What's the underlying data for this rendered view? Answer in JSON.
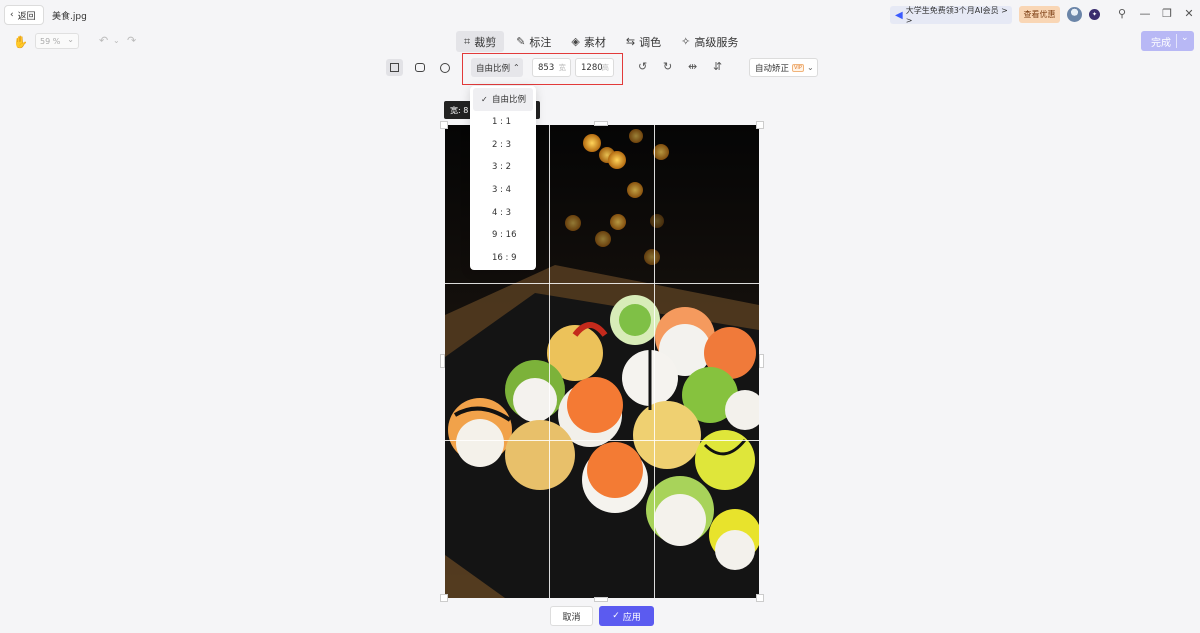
{
  "titlebar": {
    "back_label": "返回",
    "filename": "美食.jpg",
    "promo_text": "大学生免费领3个月AI会员 > >",
    "coupon_label": "查看优惠"
  },
  "toolbar": {
    "zoom_value": "59 %",
    "tabs": [
      {
        "label": "裁剪",
        "icon": "crop-icon",
        "active": true
      },
      {
        "label": "标注",
        "icon": "pen-icon",
        "active": false
      },
      {
        "label": "素材",
        "icon": "shapes-icon",
        "active": false
      },
      {
        "label": "调色",
        "icon": "sliders-icon",
        "active": false
      },
      {
        "label": "高级服务",
        "icon": "sparkle-icon",
        "active": false
      }
    ],
    "done_label": "完成"
  },
  "crop": {
    "ratio_label": "自由比例",
    "width_value": "853",
    "width_unit": "宽",
    "height_value": "1280",
    "height_unit": "高",
    "auto_correct_label": "自动矫正",
    "vip_tag": "VIP",
    "size_tip": "宽: 8",
    "ratio_options": [
      "自由比例",
      "1 : 1",
      "2 : 3",
      "3 : 2",
      "3 : 4",
      "4 : 3",
      "9 : 16",
      "16 : 9"
    ],
    "selected_ratio": "自由比例"
  },
  "actions": {
    "cancel_label": "取消",
    "apply_label": "应用"
  },
  "colors": {
    "accent": "#5b5bf0",
    "done_disabled": "#b8b8f5",
    "highlight": "#e23a3a"
  }
}
